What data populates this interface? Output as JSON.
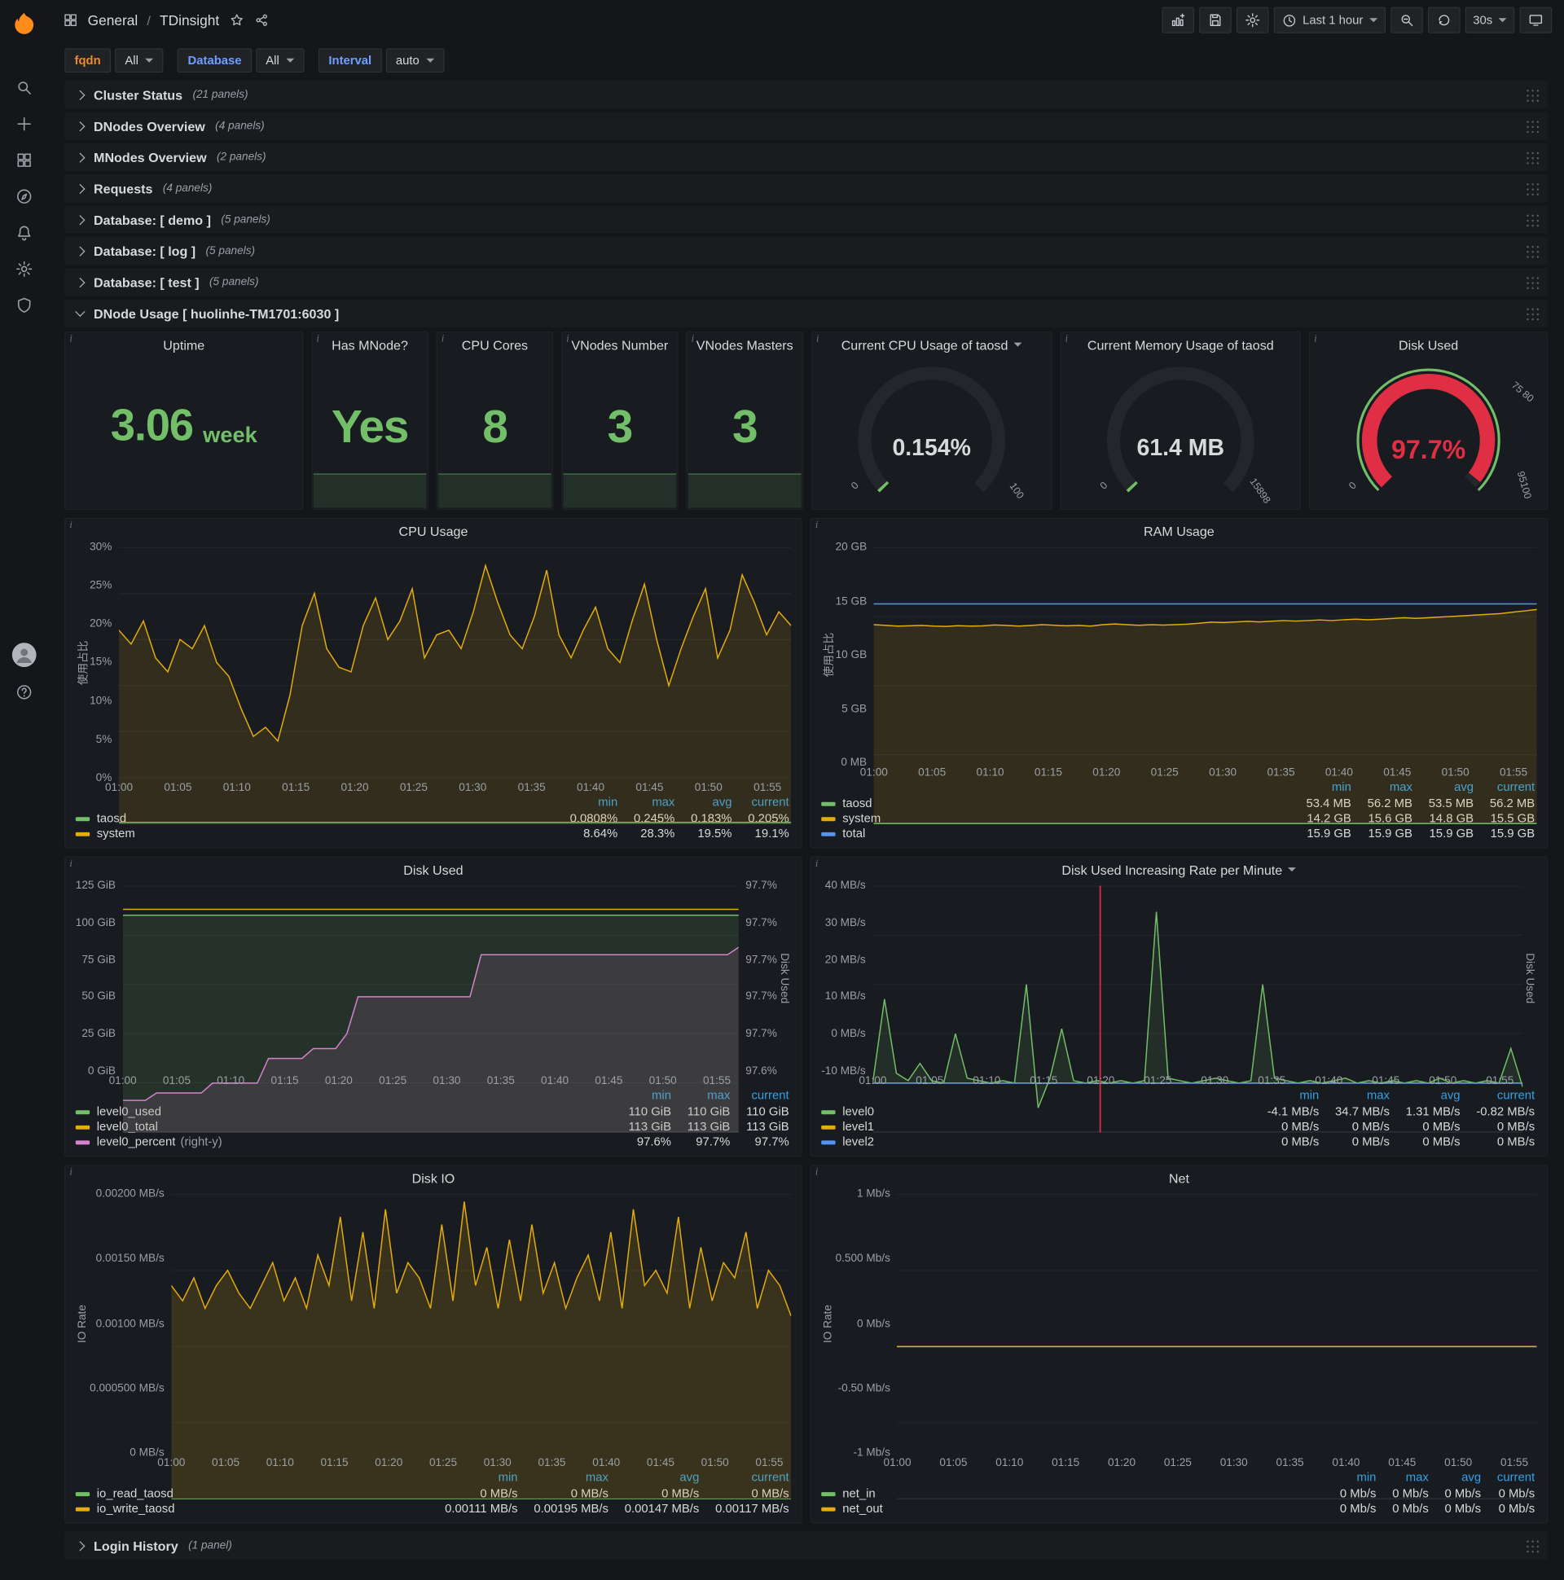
{
  "colors": {
    "green": "#73bf69",
    "yellow": "#e5ac0e",
    "blue": "#5794f2",
    "pink": "#d683ce",
    "red": "#e02f44",
    "legend_header_blue": "#33a2e5",
    "label_orange": "#eb8b2c",
    "label_blue": "#6e9fff",
    "logo_orange": "#ff8c1a"
  },
  "topnav": {
    "section": "General",
    "sep": "/",
    "title": "TDinsight",
    "time_range": "Last 1 hour",
    "refresh": "30s"
  },
  "filters": [
    {
      "label": "fqdn",
      "value": "All"
    },
    {
      "label": "Database",
      "value": "All"
    },
    {
      "label": "Interval",
      "value": "auto"
    }
  ],
  "rows": [
    {
      "title": "Cluster Status",
      "count": "(21 panels)"
    },
    {
      "title": "DNodes Overview",
      "count": "(4 panels)"
    },
    {
      "title": "MNodes Overview",
      "count": "(2 panels)"
    },
    {
      "title": "Requests",
      "count": "(4 panels)"
    },
    {
      "title": "Database: [ demo ]",
      "count": "(5 panels)"
    },
    {
      "title": "Database: [ log ]",
      "count": "(5 panels)"
    },
    {
      "title": "Database: [ test ]",
      "count": "(5 panels)"
    }
  ],
  "dnode_row": {
    "title": "DNode Usage [ huolinhe-TM1701:6030 ]"
  },
  "login_row": {
    "title": "Login History",
    "count": "(1 panel)"
  },
  "stats": [
    {
      "title": "Uptime",
      "value": "3.06",
      "unit": "week"
    },
    {
      "title": "Has MNode?",
      "value": "Yes"
    },
    {
      "title": "CPU Cores",
      "value": "8"
    },
    {
      "title": "VNodes Number",
      "value": "3"
    },
    {
      "title": "VNodes Masters",
      "value": "3"
    }
  ],
  "gauges": [
    {
      "title": "Current CPU Usage of taosd",
      "value": "0.154%",
      "min": "0",
      "max": "100",
      "pct": 0.00154,
      "color": "#73bf69",
      "ring": false,
      "value_red": false
    },
    {
      "title": "Current Memory Usage of taosd",
      "value": "61.4 MB",
      "min": "0",
      "max": "15898",
      "pct": 0.0039,
      "color": "#73bf69",
      "ring": false,
      "value_red": false
    },
    {
      "title": "Disk Used",
      "value": "97.7%",
      "min": "0",
      "th_top": "75 80",
      "th_bot": "95100",
      "pct": 0.977,
      "color": "#e02f44",
      "ring": true,
      "value_red": true
    }
  ],
  "charts": [
    {
      "type": "line",
      "title": "CPU Usage",
      "ylabel_left": "使用占比",
      "y_ticks": [
        "30%",
        "25%",
        "20%",
        "15%",
        "10%",
        "5%",
        "0%"
      ],
      "x_ticks": [
        "01:00",
        "01:05",
        "01:10",
        "01:15",
        "01:20",
        "01:25",
        "01:30",
        "01:35",
        "01:40",
        "01:45",
        "01:50",
        "01:55"
      ],
      "yrange": [
        0,
        30
      ],
      "series": [
        {
          "name": "system",
          "color": "#e5ac0e",
          "fill": 0.13,
          "values": [
            21,
            19.5,
            22,
            18,
            16.5,
            20,
            19,
            21.5,
            17.5,
            16,
            12.5,
            9.5,
            10.5,
            9,
            14,
            21.5,
            25,
            19,
            17,
            16.5,
            21.5,
            24.5,
            20,
            22,
            25.5,
            18,
            20.5,
            21,
            19,
            23,
            28,
            24,
            20.5,
            19,
            22.5,
            27.5,
            20.5,
            18,
            21,
            23.5,
            19,
            17.5,
            22,
            26,
            20,
            15,
            19,
            22.5,
            25.5,
            18,
            21,
            27,
            24,
            20.5,
            23,
            21.5
          ]
        },
        {
          "name": "taosd",
          "color": "#73bf69",
          "const": 0.2
        }
      ],
      "legend": {
        "cols": [
          "min",
          "max",
          "avg",
          "current"
        ],
        "rows": [
          {
            "name": "taosd",
            "color": "#73bf69",
            "vals": [
              "0.0808%",
              "0.245%",
              "0.183%",
              "0.205%"
            ]
          },
          {
            "name": "system",
            "color": "#e5ac0e",
            "vals": [
              "8.64%",
              "28.3%",
              "19.5%",
              "19.1%"
            ]
          }
        ]
      }
    },
    {
      "type": "line",
      "title": "RAM Usage",
      "ylabel_left": "使用占比",
      "y_ticks": [
        "20 GB",
        "15 GB",
        "10 GB",
        "5 GB",
        "0 MB"
      ],
      "x_ticks": [
        "01:00",
        "01:05",
        "01:10",
        "01:15",
        "01:20",
        "01:25",
        "01:30",
        "01:35",
        "01:40",
        "01:45",
        "01:50",
        "01:55"
      ],
      "yrange": [
        0,
        20
      ],
      "series": [
        {
          "name": "system",
          "color": "#e5ac0e",
          "fill": 0.13,
          "values": [
            14.4,
            14.35,
            14.3,
            14.32,
            14.35,
            14.3,
            14.28,
            14.33,
            14.3,
            14.31,
            14.38,
            14.35,
            14.3,
            14.34,
            14.4,
            14.36,
            14.32,
            14.35,
            14.3,
            14.4,
            14.45,
            14.4,
            14.36,
            14.4,
            14.37,
            14.4,
            14.44,
            14.5,
            14.58,
            14.55,
            14.6,
            14.64,
            14.6,
            14.65,
            14.7,
            14.66,
            14.7,
            14.74,
            14.7,
            14.76,
            14.8,
            14.76,
            14.8,
            14.85,
            14.9,
            14.86,
            14.9,
            14.95,
            15,
            15.05,
            15.1,
            15.15,
            15.2,
            15.3,
            15.4,
            15.5
          ]
        },
        {
          "name": "taosd",
          "color": "#73bf69",
          "const": 0.054
        },
        {
          "name": "total",
          "color": "#5794f2",
          "const": 15.9
        }
      ],
      "legend": {
        "cols": [
          "min",
          "max",
          "avg",
          "current"
        ],
        "rows": [
          {
            "name": "taosd",
            "color": "#73bf69",
            "vals": [
              "53.4 MB",
              "56.2 MB",
              "53.5 MB",
              "56.2 MB"
            ]
          },
          {
            "name": "system",
            "color": "#e5ac0e",
            "vals": [
              "14.2 GB",
              "15.6 GB",
              "14.8 GB",
              "15.5 GB"
            ]
          },
          {
            "name": "total",
            "color": "#5794f2",
            "vals": [
              "15.9 GB",
              "15.9 GB",
              "15.9 GB",
              "15.9 GB"
            ]
          }
        ]
      }
    },
    {
      "type": "line",
      "title": "Disk Used",
      "ylabel_right": "Disk Used",
      "y_ticks": [
        "125 GiB",
        "100 GiB",
        "75 GiB",
        "50 GiB",
        "25 GiB",
        "0 GiB"
      ],
      "y_ticks_right": [
        "97.7%",
        "97.7%",
        "97.7%",
        "97.7%",
        "97.7%",
        "97.6%"
      ],
      "x_ticks": [
        "01:00",
        "01:05",
        "01:10",
        "01:15",
        "01:20",
        "01:25",
        "01:30",
        "01:35",
        "01:40",
        "01:45",
        "01:50",
        "01:55"
      ],
      "yrange": [
        0,
        125
      ],
      "yrange_right": [
        97.55,
        97.75
      ],
      "series": [
        {
          "name": "level0_used",
          "color": "#73bf69",
          "fill": 0.15,
          "const": 110
        },
        {
          "name": "level0_total",
          "color": "#e5ac0e",
          "const": 113
        },
        {
          "name": "level0_percent",
          "color": "#d683ce",
          "axis": "right",
          "fill": 0.13,
          "values": [
            97.576,
            97.576,
            97.576,
            97.582,
            97.582,
            97.582,
            97.582,
            97.582,
            97.59,
            97.59,
            97.59,
            97.59,
            97.59,
            97.61,
            97.61,
            97.61,
            97.61,
            97.618,
            97.618,
            97.618,
            97.63,
            97.66,
            97.66,
            97.66,
            97.66,
            97.66,
            97.66,
            97.66,
            97.66,
            97.66,
            97.66,
            97.66,
            97.694,
            97.694,
            97.694,
            97.694,
            97.694,
            97.694,
            97.694,
            97.694,
            97.694,
            97.694,
            97.694,
            97.694,
            97.694,
            97.694,
            97.694,
            97.694,
            97.694,
            97.694,
            97.694,
            97.694,
            97.694,
            97.694,
            97.694,
            97.7
          ]
        }
      ],
      "legend": {
        "cols": [
          "min",
          "max",
          "current"
        ],
        "rows": [
          {
            "name": "level0_used",
            "color": "#73bf69",
            "vals": [
              "110 GiB",
              "110 GiB",
              "110 GiB"
            ]
          },
          {
            "name": "level0_total",
            "color": "#e5ac0e",
            "vals": [
              "113 GiB",
              "113 GiB",
              "113 GiB"
            ]
          },
          {
            "name": "level0_percent",
            "note": "(right-y)",
            "color": "#d683ce",
            "vals": [
              "97.6%",
              "97.7%",
              "97.7%"
            ]
          }
        ]
      }
    },
    {
      "type": "line",
      "title": "Disk Used Increasing Rate per Minute",
      "title_caret": true,
      "ylabel_right": "Disk Used",
      "y_ticks": [
        "40 MB/s",
        "30 MB/s",
        "20 MB/s",
        "10 MB/s",
        "0 MB/s",
        "-10 MB/s"
      ],
      "x_ticks": [
        "01:00",
        "01:05",
        "01:10",
        "01:15",
        "01:20",
        "01:25",
        "01:30",
        "01:35",
        "01:40",
        "01:45",
        "01:50",
        "01:55"
      ],
      "yrange": [
        -10,
        40
      ],
      "annotation_x": 0.35,
      "series": [
        {
          "name": "level0",
          "color": "#73bf69",
          "fill": 0.12,
          "values": [
            0,
            17,
            2,
            0.5,
            4,
            0.5,
            0,
            10,
            1,
            0.5,
            0,
            0.5,
            0,
            20,
            -5,
            1,
            11,
            0.5,
            0,
            0.5,
            0,
            0.5,
            0,
            0.5,
            34.7,
            1,
            0.5,
            0,
            0.5,
            1,
            0.5,
            0,
            0.5,
            20,
            1,
            0.5,
            0,
            0.5,
            0,
            0.5,
            1,
            0,
            0.5,
            0,
            0.5,
            0,
            0.5,
            0,
            1,
            0,
            0.5,
            0,
            0.5,
            0,
            7,
            -0.8
          ]
        },
        {
          "name": "level1",
          "color": "#e5ac0e",
          "const": 0
        },
        {
          "name": "level2",
          "color": "#5794f2",
          "const": 0
        }
      ],
      "legend": {
        "cols": [
          "min",
          "max",
          "avg",
          "current"
        ],
        "rows": [
          {
            "name": "level0",
            "color": "#73bf69",
            "vals": [
              "-4.1 MB/s",
              "34.7 MB/s",
              "1.31 MB/s",
              "-0.82 MB/s"
            ]
          },
          {
            "name": "level1",
            "color": "#e5ac0e",
            "vals": [
              "0 MB/s",
              "0 MB/s",
              "0 MB/s",
              "0 MB/s"
            ]
          },
          {
            "name": "level2",
            "color": "#5794f2",
            "vals": [
              "0 MB/s",
              "0 MB/s",
              "0 MB/s",
              "0 MB/s"
            ]
          }
        ]
      }
    },
    {
      "type": "line",
      "title": "Disk IO",
      "ylabel_left": "IO Rate",
      "y_ticks": [
        "0.00200 MB/s",
        "0.00150 MB/s",
        "0.00100 MB/s",
        "0.000500 MB/s",
        "0 MB/s"
      ],
      "x_ticks": [
        "01:00",
        "01:05",
        "01:10",
        "01:15",
        "01:20",
        "01:25",
        "01:30",
        "01:35",
        "01:40",
        "01:45",
        "01:50",
        "01:55"
      ],
      "yrange": [
        0,
        0.002
      ],
      "series": [
        {
          "name": "io_write_taosd",
          "color": "#e5ac0e",
          "fill": 0.16,
          "values": [
            0.0014,
            0.0013,
            0.00145,
            0.00125,
            0.0014,
            0.0015,
            0.00135,
            0.00125,
            0.0014,
            0.00155,
            0.0013,
            0.00145,
            0.00125,
            0.0016,
            0.0014,
            0.00185,
            0.0013,
            0.00175,
            0.00125,
            0.0019,
            0.00135,
            0.00155,
            0.00145,
            0.00125,
            0.0018,
            0.0013,
            0.00195,
            0.0014,
            0.00165,
            0.00125,
            0.0017,
            0.0013,
            0.0018,
            0.00135,
            0.00155,
            0.00125,
            0.00145,
            0.0016,
            0.0013,
            0.00175,
            0.00125,
            0.0019,
            0.0014,
            0.0015,
            0.00135,
            0.00185,
            0.00125,
            0.00165,
            0.0013,
            0.00155,
            0.00145,
            0.00175,
            0.00125,
            0.0015,
            0.0014,
            0.0012
          ]
        },
        {
          "name": "io_read_taosd",
          "color": "#73bf69",
          "const": 0
        }
      ],
      "legend": {
        "cols": [
          "min",
          "max",
          "avg",
          "current"
        ],
        "rows": [
          {
            "name": "io_read_taosd",
            "color": "#73bf69",
            "vals": [
              "0 MB/s",
              "0 MB/s",
              "0 MB/s",
              "0 MB/s"
            ]
          },
          {
            "name": "io_write_taosd",
            "color": "#e5ac0e",
            "vals": [
              "0.00111 MB/s",
              "0.00195 MB/s",
              "0.00147 MB/s",
              "0.00117 MB/s"
            ]
          }
        ]
      }
    },
    {
      "type": "line",
      "title": "Net",
      "ylabel_left": "IO Rate",
      "y_ticks": [
        "1 Mb/s",
        "0.500 Mb/s",
        "0 Mb/s",
        "-0.50 Mb/s",
        "-1 Mb/s"
      ],
      "x_ticks": [
        "01:00",
        "01:05",
        "01:10",
        "01:15",
        "01:20",
        "01:25",
        "01:30",
        "01:35",
        "01:40",
        "01:45",
        "01:50",
        "01:55"
      ],
      "yrange": [
        -1,
        1
      ],
      "series": [
        {
          "name": "net_in",
          "color": "#73bf69",
          "const": 0
        },
        {
          "name": "net_out",
          "color": "#e5ac0e",
          "const": 0
        }
      ],
      "legend": {
        "cols": [
          "min",
          "max",
          "avg",
          "current"
        ],
        "rows": [
          {
            "name": "net_in",
            "color": "#73bf69",
            "vals": [
              "0 Mb/s",
              "0 Mb/s",
              "0 Mb/s",
              "0 Mb/s"
            ]
          },
          {
            "name": "net_out",
            "color": "#e5ac0e",
            "vals": [
              "0 Mb/s",
              "0 Mb/s",
              "0 Mb/s",
              "0 Mb/s"
            ]
          }
        ]
      }
    }
  ]
}
